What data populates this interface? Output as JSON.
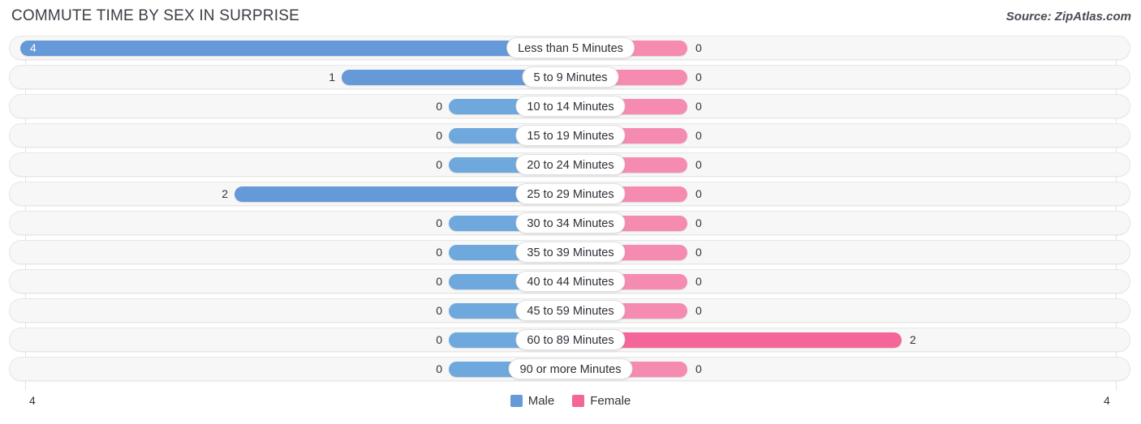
{
  "header": {
    "title": "COMMUTE TIME BY SEX IN SURPRISE",
    "source": "Source: ZipAtlas.com"
  },
  "axis": {
    "left_label": "4",
    "right_label": "4"
  },
  "legend": {
    "items": [
      {
        "label": "Male",
        "color": "#6699d8"
      },
      {
        "label": "Female",
        "color": "#f4659a"
      }
    ]
  },
  "colors": {
    "male_filled": "#6699d8",
    "male_stub": "#a8c8ea",
    "female_filled": "#f4659a",
    "female_stub": "#f7a8c4",
    "track": "#f7f7f7",
    "gridline": "#e3e3e3"
  },
  "chart_data": {
    "type": "bar",
    "subtype": "diverging-bar",
    "title": "COMMUTE TIME BY SEX IN SURPRISE",
    "xlabel": "",
    "ylabel": "",
    "xlim": [
      4,
      4
    ],
    "grid": true,
    "legend_position": "bottom-center",
    "categories": [
      "Less than 5 Minutes",
      "5 to 9 Minutes",
      "10 to 14 Minutes",
      "15 to 19 Minutes",
      "20 to 24 Minutes",
      "25 to 29 Minutes",
      "30 to 34 Minutes",
      "35 to 39 Minutes",
      "40 to 44 Minutes",
      "45 to 59 Minutes",
      "60 to 89 Minutes",
      "90 or more Minutes"
    ],
    "series": [
      {
        "name": "Male",
        "values": [
          4,
          1,
          0,
          0,
          0,
          2,
          0,
          0,
          0,
          0,
          0,
          0
        ]
      },
      {
        "name": "Female",
        "values": [
          0,
          0,
          0,
          0,
          0,
          0,
          0,
          0,
          0,
          0,
          2,
          0
        ]
      }
    ],
    "rows": [
      {
        "label": "Less than 5 Minutes",
        "male": "4",
        "female": "0"
      },
      {
        "label": "5 to 9 Minutes",
        "male": "1",
        "female": "0"
      },
      {
        "label": "10 to 14 Minutes",
        "male": "0",
        "female": "0"
      },
      {
        "label": "15 to 19 Minutes",
        "male": "0",
        "female": "0"
      },
      {
        "label": "20 to 24 Minutes",
        "male": "0",
        "female": "0"
      },
      {
        "label": "25 to 29 Minutes",
        "male": "2",
        "female": "0"
      },
      {
        "label": "30 to 34 Minutes",
        "male": "0",
        "female": "0"
      },
      {
        "label": "35 to 39 Minutes",
        "male": "0",
        "female": "0"
      },
      {
        "label": "40 to 44 Minutes",
        "male": "0",
        "female": "0"
      },
      {
        "label": "45 to 59 Minutes",
        "male": "0",
        "female": "0"
      },
      {
        "label": "60 to 89 Minutes",
        "male": "0",
        "female": "2"
      },
      {
        "label": "90 or more Minutes",
        "male": "0",
        "female": "0"
      }
    ]
  }
}
